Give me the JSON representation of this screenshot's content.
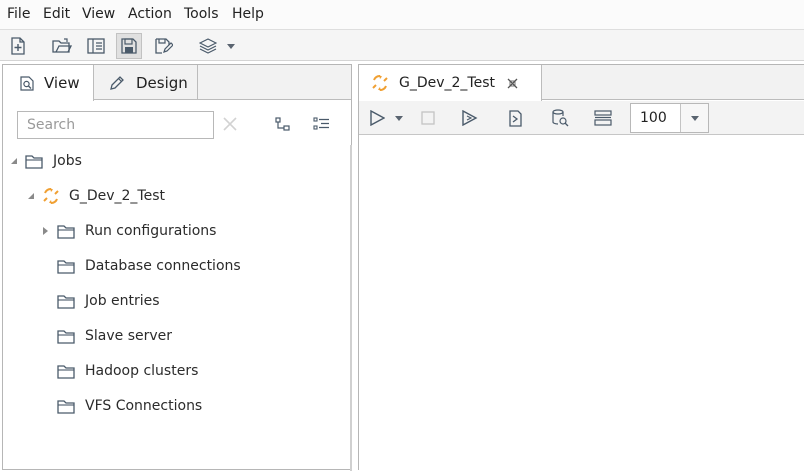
{
  "menu": [
    "File",
    "Edit",
    "View",
    "Action",
    "Tools",
    "Help"
  ],
  "toolbar": {
    "icons": [
      "new-file-icon",
      "open-folder-icon",
      "explore-repository-icon",
      "save-icon",
      "save-as-icon",
      "layers-icon",
      "dropdown-arrow-icon"
    ]
  },
  "left_panel": {
    "tabs": [
      {
        "label": "View",
        "icon": "view-icon",
        "active": true
      },
      {
        "label": "Design",
        "icon": "pencil-icon",
        "active": false
      }
    ],
    "search_placeholder": "Search",
    "tree": [
      {
        "label": "Jobs",
        "icon": "folder-icon",
        "expander": "expanded"
      },
      {
        "label": "G_Dev_2_Test",
        "icon": "job-icon",
        "expander": "expanded"
      },
      {
        "label": "Run configurations",
        "icon": "folder-icon",
        "expander": "collapsed"
      },
      {
        "label": "Database connections",
        "icon": "folder-icon",
        "expander": "none"
      },
      {
        "label": "Job entries",
        "icon": "folder-icon",
        "expander": "none"
      },
      {
        "label": "Slave server",
        "icon": "folder-icon",
        "expander": "none"
      },
      {
        "label": "Hadoop clusters",
        "icon": "folder-icon",
        "expander": "none"
      },
      {
        "label": "VFS Connections",
        "icon": "folder-icon",
        "expander": "none"
      }
    ]
  },
  "editor": {
    "tab_label": "G_Dev_2_Test",
    "toolbar_icons": [
      "run-icon",
      "run-options-dropdown-icon",
      "stop-icon",
      "preview-icon",
      "debug-icon",
      "sql-icon",
      "analyze-icon",
      "layout-icon"
    ],
    "zoom_value": "100"
  },
  "colors": {
    "accent_orange": "#f0a033",
    "icon_gray": "#4a5a6a"
  }
}
